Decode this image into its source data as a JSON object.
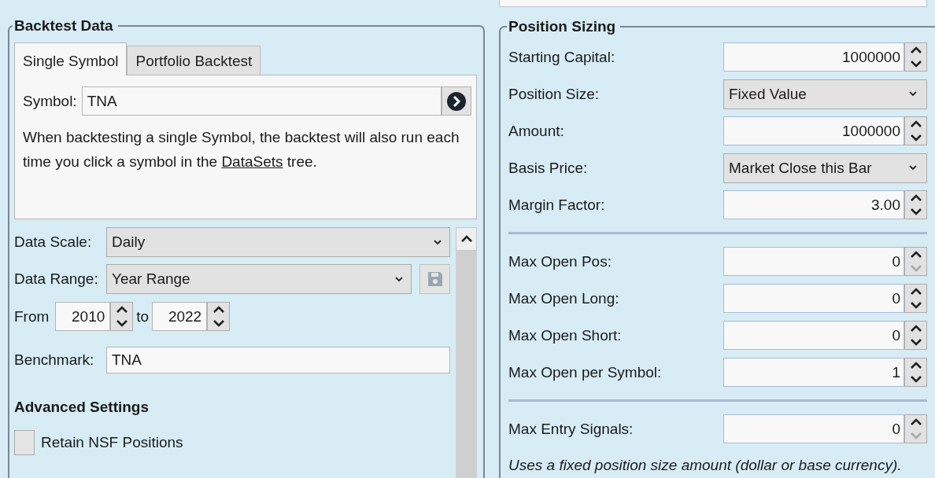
{
  "backtest_data": {
    "title": "Backtest Data",
    "tabs": [
      {
        "label": "Single Symbol",
        "selected": true
      },
      {
        "label": "Portfolio Backtest",
        "selected": false
      }
    ],
    "symbol": {
      "label": "Symbol:",
      "value": "TNA"
    },
    "description": {
      "text_before": "When backtesting a single Symbol, the backtest will also run each time you click a symbol in the ",
      "link": "DataSets",
      "text_after": " tree."
    },
    "data_scale": {
      "label": "Data Scale:",
      "value": "Daily"
    },
    "data_range": {
      "label": "Data Range:",
      "value": "Year Range",
      "save_disabled": true
    },
    "from": {
      "label": "From",
      "value": "2010"
    },
    "to": {
      "label": "to",
      "value": "2022"
    },
    "benchmark": {
      "label": "Benchmark:",
      "value": "TNA"
    },
    "advanced_title": "Advanced Settings",
    "options": [
      {
        "label": "Retain NSF Positions",
        "checked": false
      }
    ]
  },
  "position_sizing": {
    "title": "Position Sizing",
    "groups": [
      [
        {
          "kind": "spinner",
          "label": "Starting Capital:",
          "value": "1000000",
          "down_disabled": false
        },
        {
          "kind": "dropdown",
          "label": "Position Size:",
          "value": "Fixed Value"
        },
        {
          "kind": "spinner",
          "label": "Amount:",
          "value": "1000000",
          "down_disabled": false
        },
        {
          "kind": "dropdown",
          "label": "Basis Price:",
          "value": "Market Close this Bar"
        },
        {
          "kind": "spinner",
          "label": "Margin Factor:",
          "value": "3.00",
          "down_disabled": false
        }
      ],
      [
        {
          "kind": "spinner",
          "label": "Max Open Pos:",
          "value": "0",
          "down_disabled": true
        },
        {
          "kind": "spinner",
          "label": "Max Open Long:",
          "value": "0",
          "down_disabled": false
        },
        {
          "kind": "spinner",
          "label": "Max Open Short:",
          "value": "0",
          "down_disabled": false
        },
        {
          "kind": "spinner",
          "label": "Max Open per Symbol:",
          "value": "1",
          "down_disabled": false
        }
      ],
      [
        {
          "kind": "spinner",
          "label": "Max Entry Signals:",
          "value": "0",
          "down_disabled": true
        }
      ]
    ],
    "note": "Uses a fixed position size amount (dollar or base currency)."
  }
}
